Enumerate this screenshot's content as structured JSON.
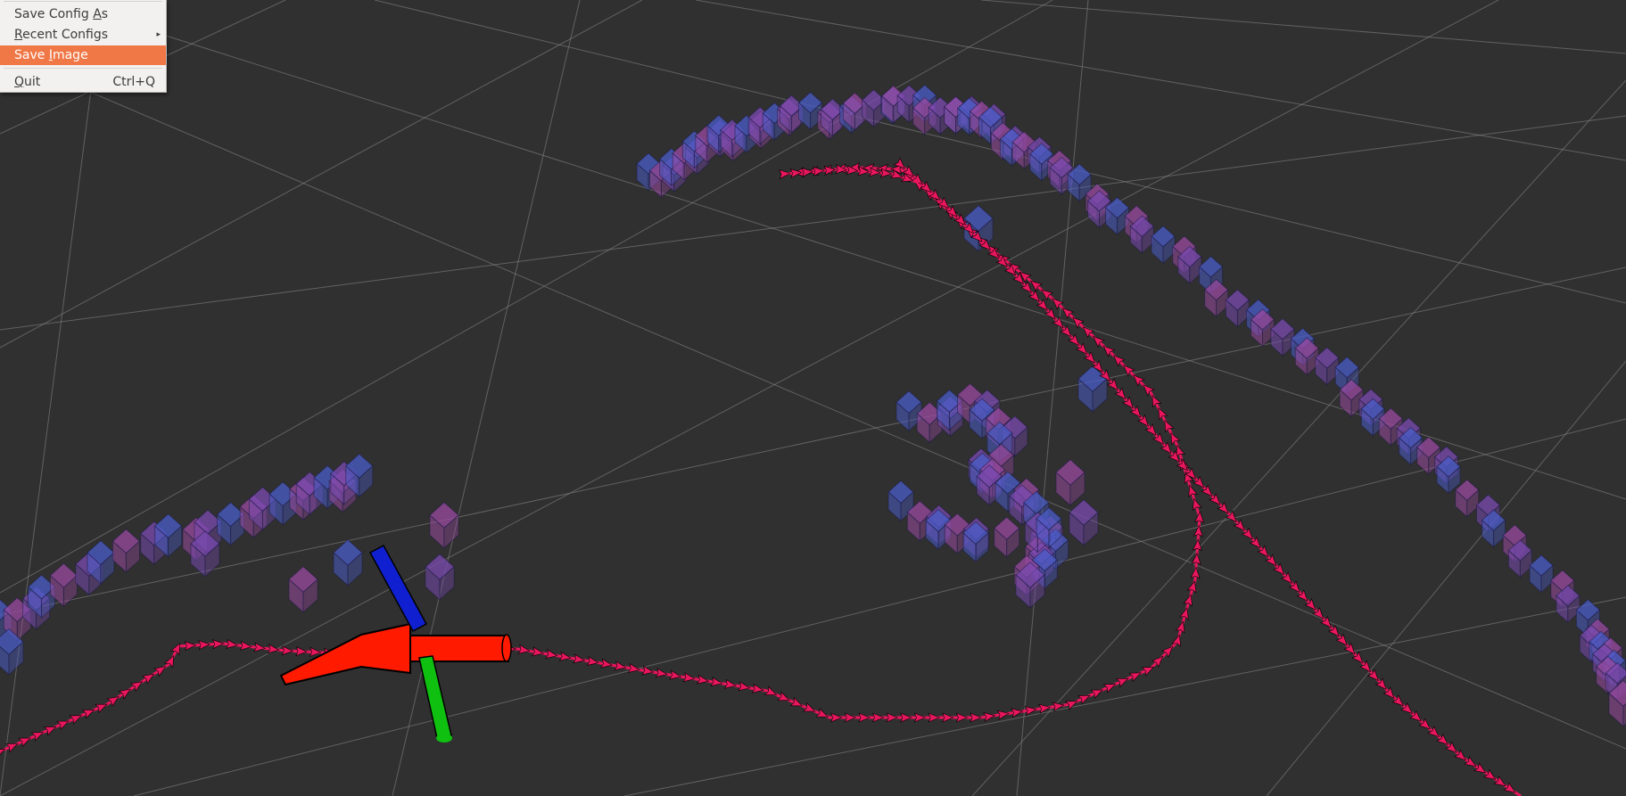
{
  "menu": {
    "items": [
      {
        "label": "Save Config As",
        "underline_index": 12
      },
      {
        "label": "Recent Configs",
        "underline_index": 0,
        "submenu": true
      },
      {
        "label": "Save Image",
        "underline_index": 5,
        "active": true
      },
      {
        "label": "Quit",
        "underline_index": 0,
        "shortcut": "Ctrl+Q"
      }
    ]
  },
  "scene": {
    "background": "#303030",
    "grid_color": "#8a8a8a",
    "path_color": "#e8175d",
    "axis_colors": {
      "x": "#ff1a00",
      "y": "#10c010",
      "z": "#1020d0"
    },
    "cube_colors": [
      "#4a5cc8",
      "#9a4aa0",
      "#7a4ab0"
    ],
    "menu_accent": "#f07746"
  }
}
